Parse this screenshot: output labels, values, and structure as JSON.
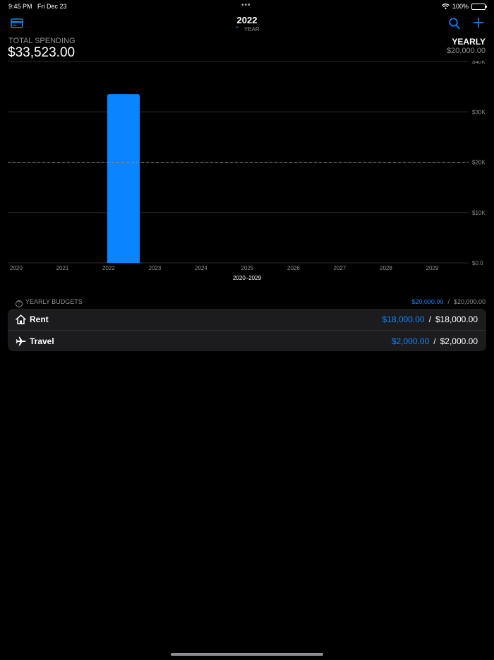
{
  "status_bar": {
    "time": "9:45 PM",
    "date": "Fri Dec 23",
    "battery": "100%"
  },
  "header": {
    "title": "2022",
    "period_label": "YEAR"
  },
  "summary": {
    "total_label": "TOTAL SPENDING",
    "total_value": "$33,523.00",
    "budget_label": "YEARLY",
    "budget_value": "$20,000.00"
  },
  "colors": {
    "accent": "#0a84ff",
    "bar": "#0a84ff",
    "background": "#000000",
    "card": "#1c1c1e"
  },
  "chart_data": {
    "type": "bar",
    "categories": [
      "2020",
      "2021",
      "2022",
      "2023",
      "2024",
      "2025",
      "2026",
      "2027",
      "2028",
      "2029"
    ],
    "values": [
      0,
      0,
      33523,
      0,
      0,
      0,
      0,
      0,
      0,
      0
    ],
    "y_ticks": [
      "$0.0",
      "$10K",
      "$20K",
      "$30K",
      "$40K"
    ],
    "ylim": [
      0,
      40000
    ],
    "budget_line": 20000,
    "grid": true,
    "range_label": "2020–2029"
  },
  "budgets": {
    "header_label": "YEARLY BUDGETS",
    "spent_total": "$20,000.00",
    "budget_total": "$20,000.00",
    "separator": "/",
    "items": [
      {
        "icon": "house-icon",
        "name": "Rent",
        "spent": "$18,000.00",
        "budget": "$18,000.00"
      },
      {
        "icon": "airplane-icon",
        "name": "Travel",
        "spent": "$2,000.00",
        "budget": "$2,000.00"
      }
    ]
  }
}
